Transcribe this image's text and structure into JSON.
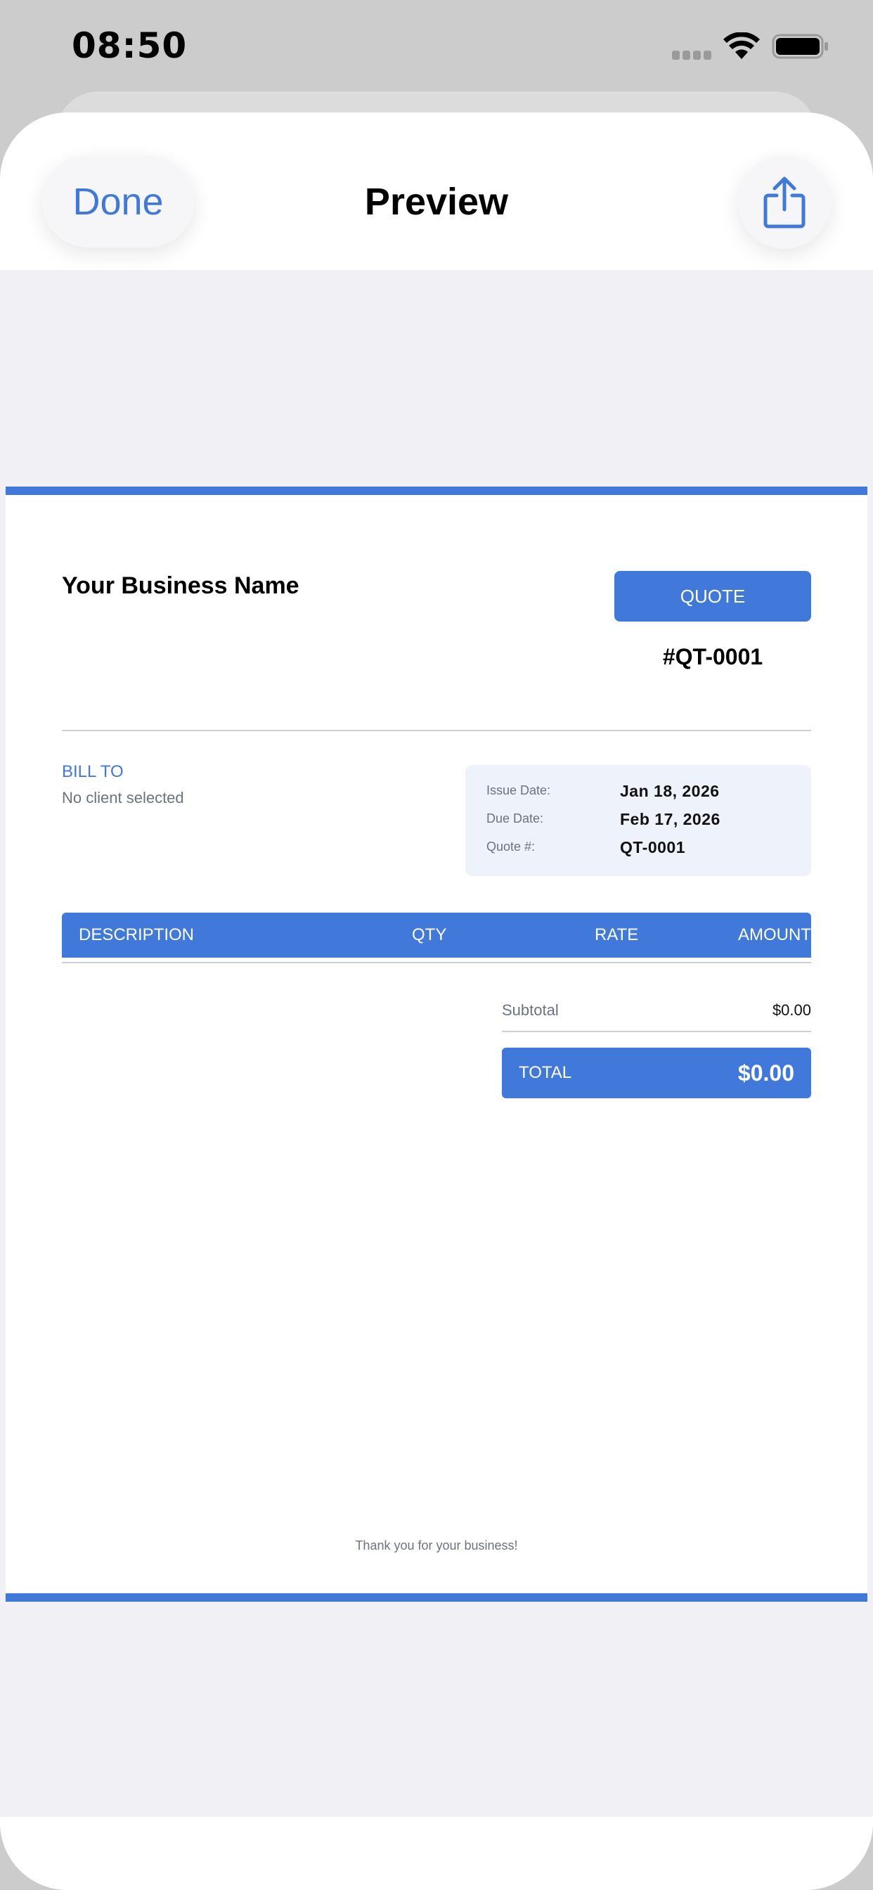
{
  "status_bar": {
    "time": "08:50"
  },
  "header": {
    "done_label": "Done",
    "title": "Preview",
    "share_icon": "share-icon"
  },
  "document": {
    "business_name": "Your Business Name",
    "type_badge": "QUOTE",
    "number": "#QT-0001",
    "bill_to": {
      "label": "BILL TO",
      "value": "No client selected"
    },
    "meta": [
      {
        "label": "Issue Date:",
        "value": "Jan 18, 2026"
      },
      {
        "label": "Due Date:",
        "value": "Feb 17, 2026"
      },
      {
        "label": "Quote #:",
        "value": "QT-0001"
      }
    ],
    "table": {
      "columns": [
        "DESCRIPTION",
        "QTY",
        "RATE",
        "AMOUNT"
      ],
      "rows": []
    },
    "subtotal": {
      "label": "Subtotal",
      "value": "$0.00"
    },
    "total": {
      "label": "TOTAL",
      "value": "$0.00"
    },
    "footer": "Thank you for your business!"
  },
  "colors": {
    "accent": "#4079d9",
    "meta_background": "#edf2fb",
    "sheet_background": "#f0f0f5"
  }
}
